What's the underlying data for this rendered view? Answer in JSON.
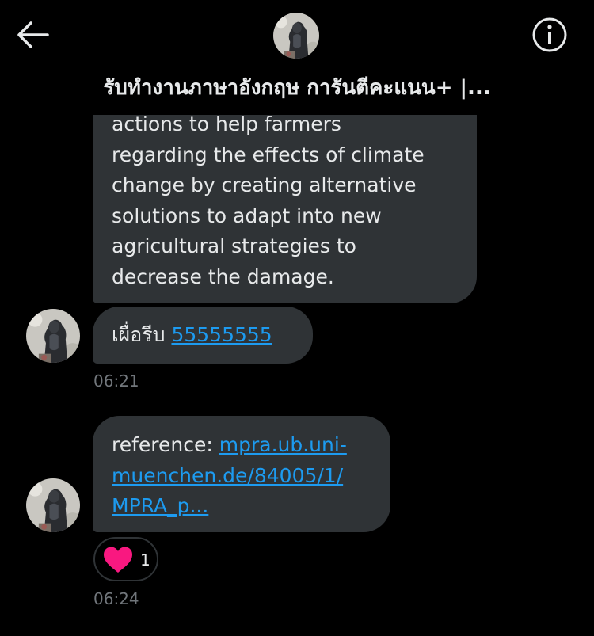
{
  "header": {
    "back_icon": "arrow-left-icon",
    "info_icon": "info-circle-icon",
    "avatar_icon": "user-avatar",
    "title": "รับทำงานภาษาอังกฤษ การันตีคะแนน+ |..."
  },
  "messages": [
    {
      "lines": [
        "actions to help farmers",
        "regarding the effects of climate",
        "change by creating alternative",
        "solutions to adapt into new",
        "agricultural strategies to",
        "decrease the damage."
      ]
    },
    {
      "text": "เผื่อรีบ",
      "link": "55555555",
      "time": "06:21"
    },
    {
      "prefix": "reference:",
      "link_lines": [
        "mpra.ub.uni-",
        "muenchen.de/84005/1/",
        "MPRA_p..."
      ],
      "reaction": {
        "icon": "heart-icon",
        "count": "1"
      },
      "time": "06:24"
    }
  ],
  "colors": {
    "background": "#000000",
    "bubble": "#2f3336",
    "text": "#e7e9ea",
    "link": "#1d9bf0",
    "muted": "#71767b",
    "heart": "#f91880"
  }
}
